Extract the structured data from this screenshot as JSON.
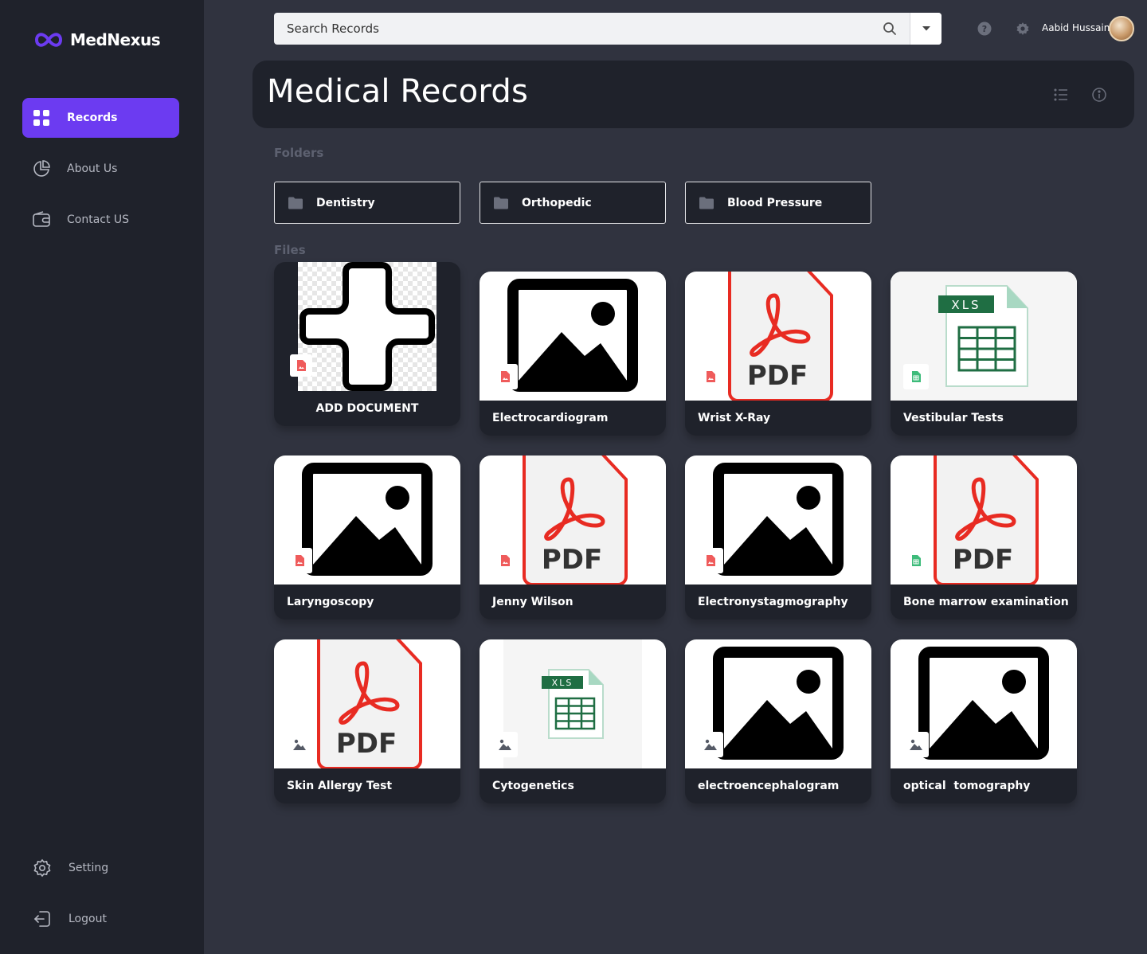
{
  "app": {
    "name": "MedNexus",
    "accent": "#6c3bf1"
  },
  "sidebar": {
    "items": [
      {
        "label": "Records",
        "icon": "grid-icon",
        "active": true
      },
      {
        "label": "About Us",
        "icon": "pie-chart-icon",
        "active": false
      },
      {
        "label": "Contact US",
        "icon": "wallet-icon",
        "active": false
      }
    ],
    "bottom": [
      {
        "label": "Setting",
        "icon": "gear-icon"
      },
      {
        "label": "Logout",
        "icon": "logout-icon"
      }
    ]
  },
  "search": {
    "placeholder": "Search Records"
  },
  "user": {
    "name": "Aabid Hussain"
  },
  "page": {
    "title": "Medical Records"
  },
  "sections": {
    "folders": "Folders",
    "files": "Files"
  },
  "folders": [
    {
      "label": "Dentistry"
    },
    {
      "label": "Orthopedic"
    },
    {
      "label": "Blood Pressure"
    }
  ],
  "add_document": {
    "label": "ADD DOCUMENT"
  },
  "files": [
    {
      "name": "Electrocardiogram",
      "thumb": "image",
      "badge": "image-file-red"
    },
    {
      "name": "Wrist X-Ray",
      "thumb": "pdf",
      "badge": "image-file-red"
    },
    {
      "name": "Vestibular Tests",
      "thumb": "xls",
      "badge": "sheet-file-green"
    },
    {
      "name": "Laryngoscopy",
      "thumb": "image",
      "badge": "image-file-red"
    },
    {
      "name": "Jenny Wilson",
      "thumb": "pdf",
      "badge": "image-file-red"
    },
    {
      "name": "Electronystagmography",
      "thumb": "image",
      "badge": "image-file-red"
    },
    {
      "name": "Bone marrow examination",
      "thumb": "pdf",
      "badge": "sheet-file-green"
    },
    {
      "name": "Skin Allergy Test",
      "thumb": "pdf",
      "badge": "image-gray"
    },
    {
      "name": "Cytogenetics",
      "thumb": "xls",
      "badge": "image-gray"
    },
    {
      "name": "electroencephalogram",
      "thumb": "image",
      "badge": "image-gray"
    },
    {
      "name": "optical  tomography",
      "thumb": "image",
      "badge": "image-gray"
    }
  ]
}
